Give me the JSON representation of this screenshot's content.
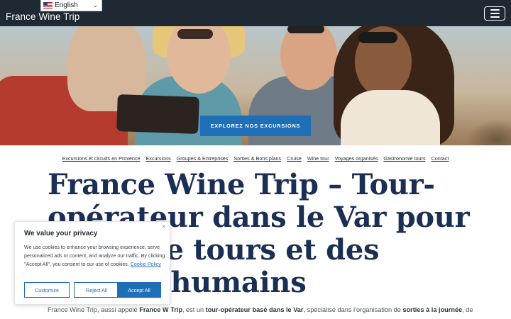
{
  "language": {
    "label": "English",
    "flag_icon": "us-flag-icon",
    "chevron_icon": "chevron-down-icon"
  },
  "site": {
    "brand": "France Wine Trip"
  },
  "hero": {
    "cta_label": "EXPLOREZ NOS EXCURSIONS"
  },
  "subnav": [
    "Excursions et circuits en Provence",
    "Excursions",
    "Groupes & Entreprises",
    "Sorties & Bons plans",
    "Cruise",
    "Wine tour",
    "Voyages organisés",
    "Gastronomie tours",
    "Contact"
  ],
  "heading": "France Wine Trip – Tour-opérateur dans le Var pour des wine tours et des séjours humains",
  "intro": {
    "p1": "France Wine Trip, aussi appelé ",
    "b1": "France W Trip",
    "p2": ", est un ",
    "b2": "tour-opérateur basé dans le Var",
    "p3": ", spécialisé dans l’organisation de ",
    "b3": "sorties à la journée",
    "p4": ", de"
  },
  "cookie": {
    "title": "We value your privacy",
    "text": "We use cookies to enhance your browsing experience, serve personalized ads or content, and analyze our traffic. By clicking \"Accept All\", you consent to our use of cookies. ",
    "policy_link": "Cookie Policy",
    "close": "×",
    "customize": "Customize",
    "reject": "Reject All",
    "accept": "Accept All"
  },
  "colors": {
    "topbar": "#1e2933",
    "accent": "#1f6fb8",
    "heading": "#1b2f55"
  }
}
